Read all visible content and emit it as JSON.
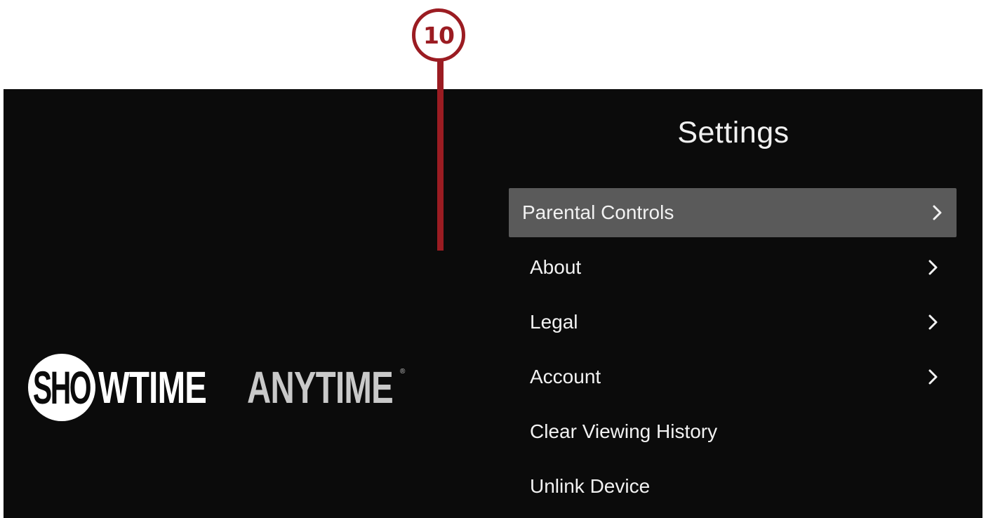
{
  "callout": {
    "number": "10",
    "color": "#9b1c22"
  },
  "logo": {
    "badge_text": "SHO",
    "word1": "WTIME",
    "word2": "ANYTIME",
    "registered_mark": "®"
  },
  "settings": {
    "title": "Settings",
    "items": [
      {
        "label": "Parental Controls",
        "has_chevron": true,
        "focused": true
      },
      {
        "label": "About",
        "has_chevron": true,
        "focused": false
      },
      {
        "label": "Legal",
        "has_chevron": true,
        "focused": false
      },
      {
        "label": "Account",
        "has_chevron": true,
        "focused": false
      },
      {
        "label": "Clear Viewing History",
        "has_chevron": false,
        "focused": false
      },
      {
        "label": "Unlink Device",
        "has_chevron": false,
        "focused": false
      }
    ]
  },
  "colors": {
    "screen_background": "#0b0b0b",
    "focused_item_background": "#5a5a5a",
    "text": "#f2f2f2",
    "logo_secondary": "#c9c9c9"
  },
  "icons": {
    "chevron": "chevron-right-icon"
  }
}
